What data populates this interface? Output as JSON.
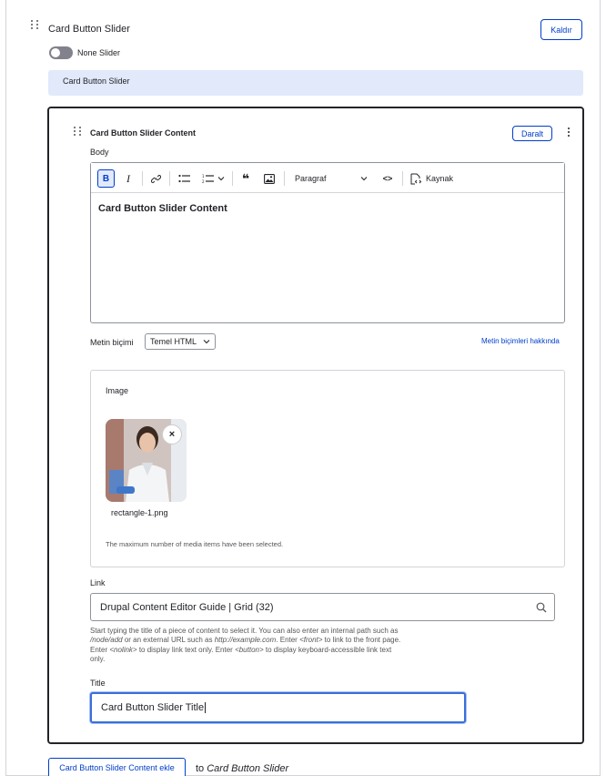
{
  "outer": {
    "title": "Card Button Slider",
    "remove_label": "Kaldır",
    "toggle_label": "None Slider",
    "summary": "Card Button Slider"
  },
  "inner": {
    "title": "Card Button Slider Content",
    "collapse_label": "Daralt",
    "body_label": "Body",
    "toolbar": {
      "bold": "B",
      "italic": "I",
      "quote": "❝",
      "format_select": "Paragraf",
      "code": "<>",
      "source_label": "Kaynak"
    },
    "editor_content": "Card Button Slider Content",
    "text_format_label": "Metin biçimi",
    "text_format_value": "Temel HTML",
    "text_format_help_link": "Metin biçimleri hakkında",
    "image": {
      "label": "Image",
      "remove": "×",
      "filename": "rectangle-1.png",
      "max_note": "The maximum number of media items have been selected."
    },
    "link": {
      "label": "Link",
      "value": "Drupal Content Editor Guide | Grid (32)",
      "help": {
        "p1": "Start typing the title of a piece of content to select it. You can also enter an internal path such as ",
        "e1": "/node/add",
        "p2": " or an external URL such as ",
        "e2": "http://example.com",
        "p3": ". Enter ",
        "e3": "<front>",
        "p4": " to link to the front page. Enter ",
        "e4": "<nolink>",
        "p5": " to display link text only. Enter ",
        "e5": "<button>",
        "p6": " to display keyboard-accessible link text only."
      }
    },
    "title_field": {
      "label": "Title",
      "value": "Card Button Slider Title"
    }
  },
  "add_row": {
    "button_label": "Card Button Slider Content ekle",
    "to_text": "to ",
    "target": "Card Button Slider"
  }
}
